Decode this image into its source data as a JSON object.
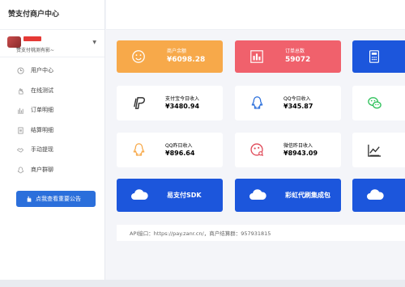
{
  "sidebar": {
    "brand": "赞支付商户中心",
    "user_subtitle": "赞支付桃测有影~",
    "menu": [
      {
        "label": "用户中心",
        "icon": "clock-icon"
      },
      {
        "label": "在线测试",
        "icon": "hand-icon"
      },
      {
        "label": "订单明细",
        "icon": "bar-chart-icon"
      },
      {
        "label": "结算明细",
        "icon": "document-icon"
      },
      {
        "label": "手动提现",
        "icon": "handshake-icon"
      },
      {
        "label": "商户群聊",
        "icon": "qq-icon"
      }
    ],
    "notice_button": "点我查看重要公告"
  },
  "stats": [
    {
      "label": "商户余额",
      "value": "¥6098.28",
      "color": "#f7a94a",
      "icon": "smile-icon"
    },
    {
      "label": "订单总数",
      "value": "59072",
      "color": "#f0616c",
      "icon": "bar-chart-icon"
    },
    {
      "label": "",
      "value": "",
      "color": "#1c56dc",
      "icon": "calculator-icon"
    }
  ],
  "income_row1": [
    {
      "label": "支付宝今日收入",
      "value": "¥3480.94",
      "icon": "paypal-icon",
      "icon_color": "#333333"
    },
    {
      "label": "QQ今日收入",
      "value": "¥345.87",
      "icon": "qq-icon",
      "icon_color": "#2b6fdb"
    },
    {
      "label": "",
      "value": "",
      "icon": "wechat-icon",
      "icon_color": "#2ec15a"
    }
  ],
  "income_row2": [
    {
      "label": "QQ昨日收入",
      "value": "¥896.64",
      "icon": "qq-icon",
      "icon_color": "#f7a94a"
    },
    {
      "label": "微信昨日收入",
      "value": "¥8943.09",
      "icon": "gamepad-icon",
      "icon_color": "#e04a59"
    },
    {
      "label": "",
      "value": "",
      "icon": "line-chart-icon",
      "icon_color": "#333333"
    }
  ],
  "promo": [
    {
      "label": "易支付SDK",
      "icon": "cloud-icon"
    },
    {
      "label": "彩虹代刷集成包",
      "icon": "cloud-icon"
    },
    {
      "label": "",
      "icon": "cloud-icon"
    }
  ],
  "footer_text": "API接口：https://pay.zanr.cn/，商户结算群：957931815"
}
